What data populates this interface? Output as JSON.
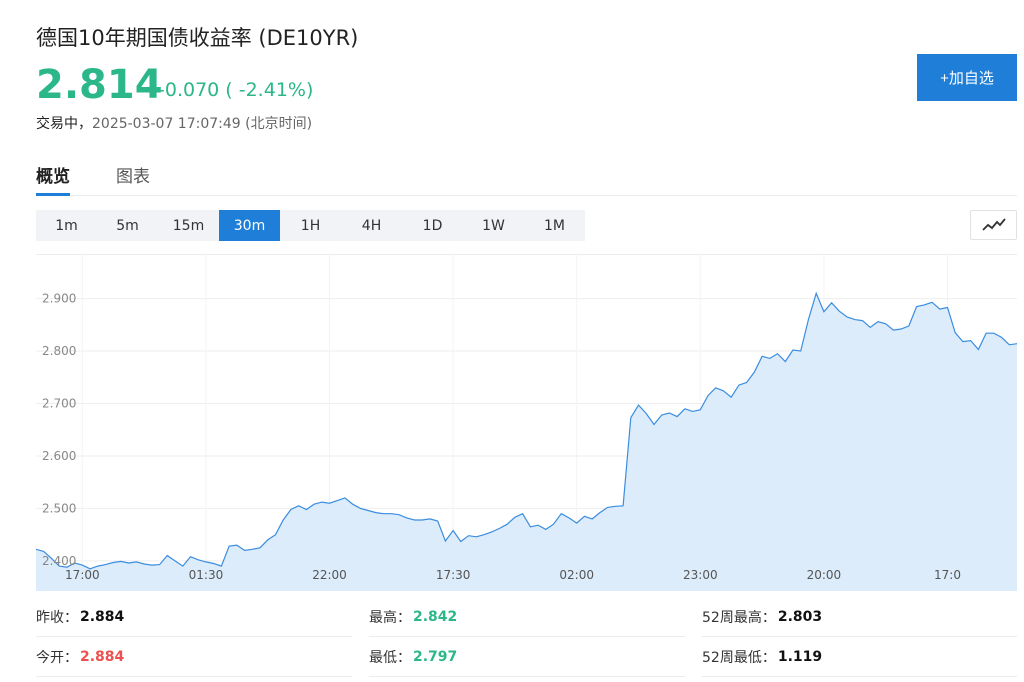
{
  "header": {
    "title": "德国10年期国债收益率 (DE10YR)",
    "price": "2.814",
    "change": "-0.070 ( -2.41%)",
    "status_state": "交易中，",
    "status_time": "2025-03-07 17:07:49 (北京时间)",
    "add_watchlist_label": "+加自选"
  },
  "tabs": [
    {
      "label": "概览",
      "active": true
    },
    {
      "label": "图表",
      "active": false
    }
  ],
  "intervals": [
    {
      "label": "1m",
      "active": false
    },
    {
      "label": "5m",
      "active": false
    },
    {
      "label": "15m",
      "active": false
    },
    {
      "label": "30m",
      "active": true
    },
    {
      "label": "1H",
      "active": false
    },
    {
      "label": "4H",
      "active": false
    },
    {
      "label": "1D",
      "active": false
    },
    {
      "label": "1W",
      "active": false
    },
    {
      "label": "1M",
      "active": false
    }
  ],
  "chart_type_icon": "line-chart-icon",
  "colors": {
    "accent": "#1f7fd8",
    "up_green": "#2bb78a",
    "down_red": "#ee4f4f",
    "area_fill": "#dcecfb",
    "line": "#3b8de0"
  },
  "chart_data": {
    "type": "area",
    "ylim": [
      2.375,
      2.985
    ],
    "yticks": [
      "2.900",
      "2.800",
      "2.700",
      "2.600",
      "2.500",
      "2.400"
    ],
    "ytick_values": [
      2.9,
      2.8,
      2.7,
      2.6,
      2.5,
      2.4
    ],
    "xticks": [
      "17:00",
      "01:30",
      "22:00",
      "17:30",
      "02:00",
      "23:00",
      "20:00",
      "17:0"
    ],
    "xtick_index": [
      6,
      22,
      38,
      54,
      70,
      86,
      102,
      118
    ],
    "grid": true,
    "values": [
      2.422,
      2.418,
      2.405,
      2.39,
      2.388,
      2.396,
      2.392,
      2.385,
      2.39,
      2.393,
      2.397,
      2.399,
      2.396,
      2.398,
      2.394,
      2.392,
      2.393,
      2.41,
      2.4,
      2.39,
      2.408,
      2.402,
      2.398,
      2.395,
      2.39,
      2.428,
      2.43,
      2.42,
      2.422,
      2.425,
      2.44,
      2.45,
      2.478,
      2.498,
      2.505,
      2.498,
      2.508,
      2.512,
      2.51,
      2.515,
      2.52,
      2.508,
      2.5,
      2.496,
      2.492,
      2.49,
      2.49,
      2.488,
      2.482,
      2.478,
      2.478,
      2.48,
      2.476,
      2.438,
      2.458,
      2.437,
      2.448,
      2.446,
      2.45,
      2.455,
      2.462,
      2.47,
      2.483,
      2.49,
      2.465,
      2.468,
      2.46,
      2.47,
      2.49,
      2.482,
      2.472,
      2.485,
      2.48,
      2.492,
      2.502,
      2.504,
      2.505,
      2.673,
      2.697,
      2.681,
      2.66,
      2.678,
      2.682,
      2.675,
      2.69,
      2.685,
      2.688,
      2.715,
      2.73,
      2.724,
      2.712,
      2.735,
      2.74,
      2.76,
      2.79,
      2.786,
      2.795,
      2.78,
      2.802,
      2.8,
      2.86,
      2.91,
      2.875,
      2.892,
      2.876,
      2.865,
      2.86,
      2.858,
      2.845,
      2.856,
      2.852,
      2.84,
      2.842,
      2.848,
      2.885,
      2.888,
      2.893,
      2.88,
      2.883,
      2.835,
      2.818,
      2.82,
      2.803,
      2.834,
      2.834,
      2.826,
      2.812,
      2.814
    ]
  },
  "stats": [
    [
      {
        "label": "昨收：",
        "value": "2.884",
        "color": "dark"
      },
      {
        "label": "最高：",
        "value": "2.842",
        "color": "green"
      },
      {
        "label": "52周最高：",
        "value": "2.803",
        "color": "dark"
      }
    ],
    [
      {
        "label": "今开：",
        "value": "2.884",
        "color": "red"
      },
      {
        "label": "最低：",
        "value": "2.797",
        "color": "green"
      },
      {
        "label": "52周最低：",
        "value": "1.119",
        "color": "dark"
      }
    ]
  ]
}
